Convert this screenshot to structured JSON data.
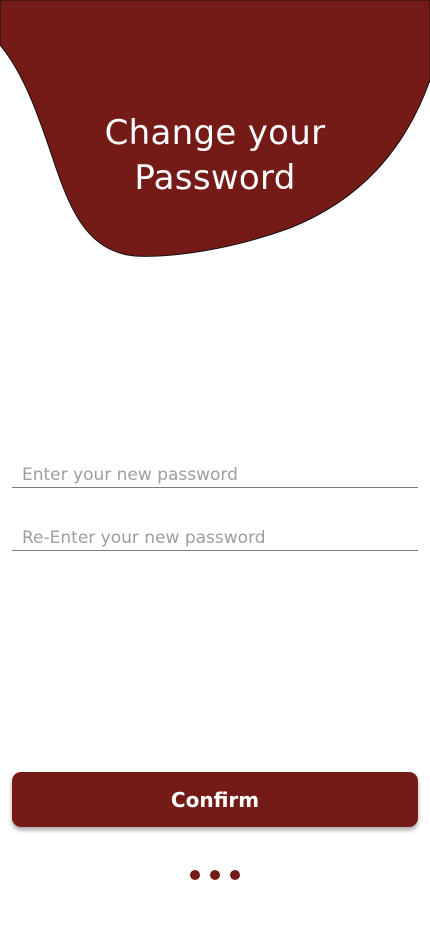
{
  "colors": {
    "accent": "#751b17",
    "background": "#ffffff",
    "title_text": "#ffffff"
  },
  "header": {
    "title_line1": "Change your",
    "title_line2": "Password"
  },
  "form": {
    "new_password": {
      "value": "",
      "placeholder": "Enter your new password"
    },
    "confirm_password": {
      "value": "",
      "placeholder": "Re-Enter your new password"
    },
    "confirm_label": "Confirm"
  },
  "loading_indicator": {
    "icon": "three-dots-loading-icon",
    "dot_count": 3
  }
}
